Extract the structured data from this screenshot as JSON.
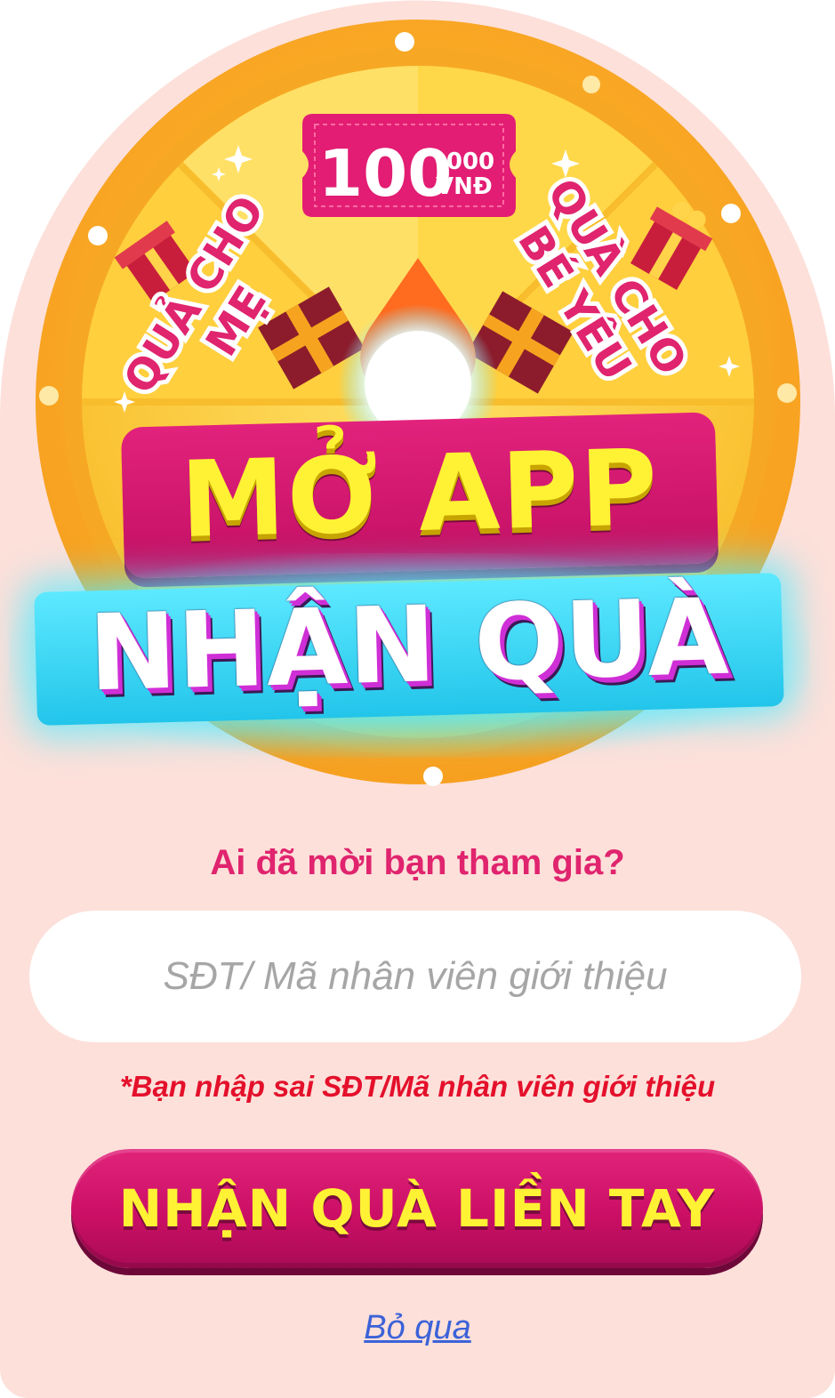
{
  "promo": {
    "prize_amount_main": "100",
    "prize_amount_thousands": ".000",
    "prize_currency": "VNĐ",
    "prize_left_line1": "QUẢ CHO",
    "prize_left_line2": "MẸ",
    "prize_right_line1": "QUÀ CHO",
    "prize_right_line2": "BÉ YÊU",
    "headline_line1": "MỞ APP",
    "headline_line2": "NHẬN QUÀ"
  },
  "form": {
    "question": "Ai đã mời bạn tham gia?",
    "referral_placeholder": "SĐT/ Mã nhân viên giới thiệu",
    "error_message": "*Bạn nhập sai SĐT/Mã nhân viên giới thiệu",
    "submit_label": "NHẬN QUÀ LIỀN TAY",
    "skip_label": "Bỏ qua"
  },
  "colors": {
    "card_background": "#fde0da",
    "accent_pink": "#e0246e",
    "headline_yellow": "#fff234",
    "error_red": "#e4102b",
    "link_blue": "#3c62d8"
  }
}
